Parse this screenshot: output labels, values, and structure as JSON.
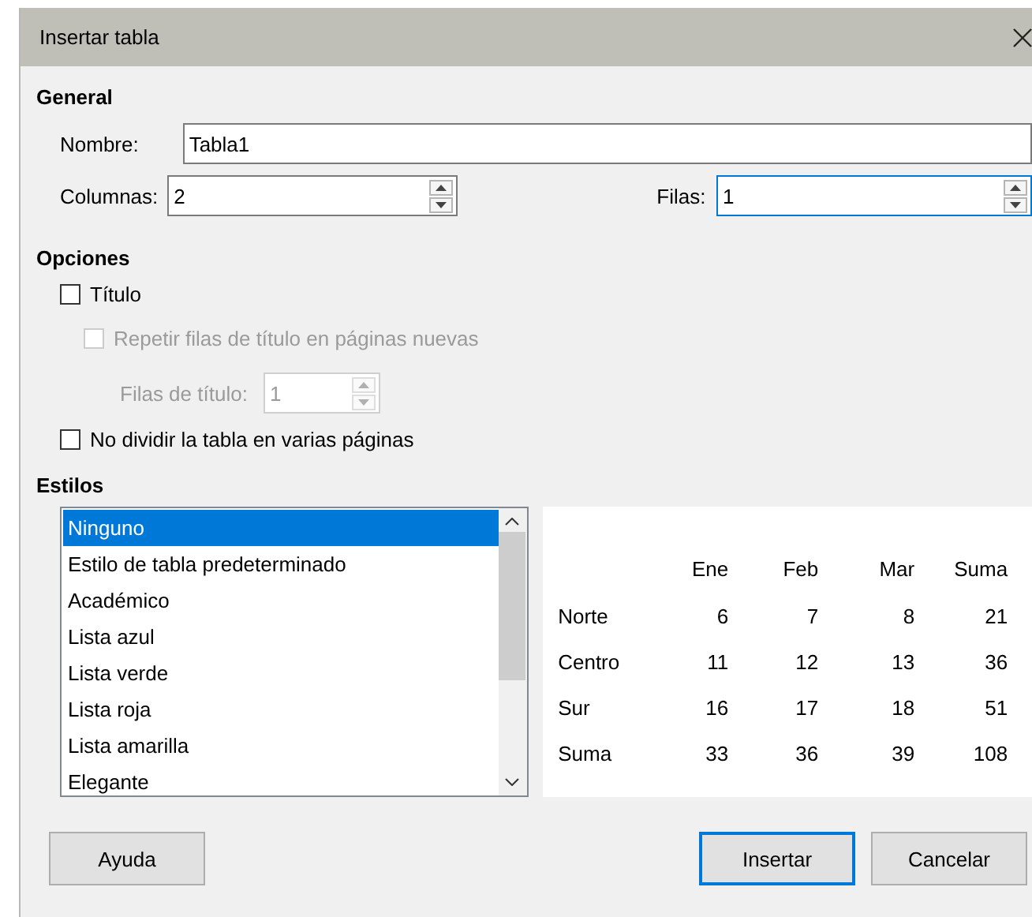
{
  "window": {
    "title": "Insertar tabla"
  },
  "general": {
    "heading": "General",
    "name": {
      "label": "Nombre:",
      "value": "Tabla1"
    },
    "columns": {
      "label": "Columnas:",
      "value": "2",
      "focused": false
    },
    "rows": {
      "label": "Filas:",
      "value": "1",
      "focused": true
    }
  },
  "options": {
    "heading": "Opciones",
    "items": [
      {
        "kind": "checkbox",
        "label": "Título",
        "checked": false,
        "disabled": false,
        "children": [
          {
            "kind": "checkbox",
            "label": "Repetir filas de título en páginas nuevas",
            "checked": false,
            "disabled": true,
            "children": [
              {
                "kind": "spin",
                "label": "Filas de título:",
                "value": "1",
                "disabled": true
              }
            ]
          }
        ]
      },
      {
        "kind": "checkbox",
        "label": "No dividir la tabla en varias páginas",
        "checked": false,
        "disabled": false
      }
    ]
  },
  "styles": {
    "heading": "Estilos",
    "items": [
      {
        "label": "Ninguno",
        "selected": true
      },
      {
        "label": "Estilo de tabla predeterminado",
        "selected": false
      },
      {
        "label": "Académico",
        "selected": false
      },
      {
        "label": "Lista azul",
        "selected": false
      },
      {
        "label": "Lista verde",
        "selected": false
      },
      {
        "label": "Lista roja",
        "selected": false
      },
      {
        "label": "Lista amarilla",
        "selected": false
      },
      {
        "label": "Elegante",
        "selected": false
      }
    ],
    "preview": {
      "columns": [
        "Ene",
        "Feb",
        "Mar",
        "Suma"
      ],
      "rows": [
        {
          "label": "Norte",
          "cells": [
            "6",
            "7",
            "8",
            "21"
          ]
        },
        {
          "label": "Centro",
          "cells": [
            "11",
            "12",
            "13",
            "36"
          ]
        },
        {
          "label": "Sur",
          "cells": [
            "16",
            "17",
            "18",
            "51"
          ]
        },
        {
          "label": "Suma",
          "cells": [
            "33",
            "36",
            "39",
            "108"
          ]
        }
      ]
    }
  },
  "buttons": [
    {
      "label": "Ayuda",
      "kind": "help",
      "default": false
    },
    {
      "label": "Insertar",
      "kind": "action",
      "default": true
    },
    {
      "label": "Cancelar",
      "kind": "action",
      "default": false
    }
  ]
}
